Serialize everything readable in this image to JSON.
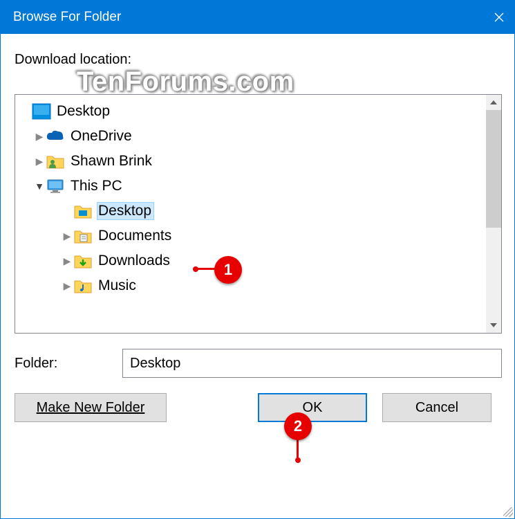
{
  "title": "Browse For Folder",
  "download_label": "Download location:",
  "watermark": "TenForums.com",
  "tree": [
    {
      "level": 0,
      "expander": "",
      "icon": "monitor-desktop",
      "label": "Desktop",
      "selected": false
    },
    {
      "level": 1,
      "expander": "▶",
      "icon": "onedrive",
      "label": "OneDrive",
      "selected": false
    },
    {
      "level": 1,
      "expander": "▶",
      "icon": "user-folder",
      "label": "Shawn Brink",
      "selected": false
    },
    {
      "level": 1,
      "expander": "▼",
      "icon": "this-pc",
      "label": "This PC",
      "selected": false
    },
    {
      "level": 2,
      "expander": "",
      "icon": "folder-desktop",
      "label": "Desktop",
      "selected": true
    },
    {
      "level": 2,
      "expander": "▶",
      "icon": "folder-documents",
      "label": "Documents",
      "selected": false
    },
    {
      "level": 2,
      "expander": "▶",
      "icon": "folder-downloads",
      "label": "Downloads",
      "selected": false
    },
    {
      "level": 2,
      "expander": "▶",
      "icon": "folder-music",
      "label": "Music",
      "selected": false
    }
  ],
  "folder_label": "Folder:",
  "folder_value": "Desktop",
  "buttons": {
    "make": "Make New Folder",
    "ok": "OK",
    "cancel": "Cancel"
  },
  "callouts": {
    "c1": "1",
    "c2": "2"
  }
}
